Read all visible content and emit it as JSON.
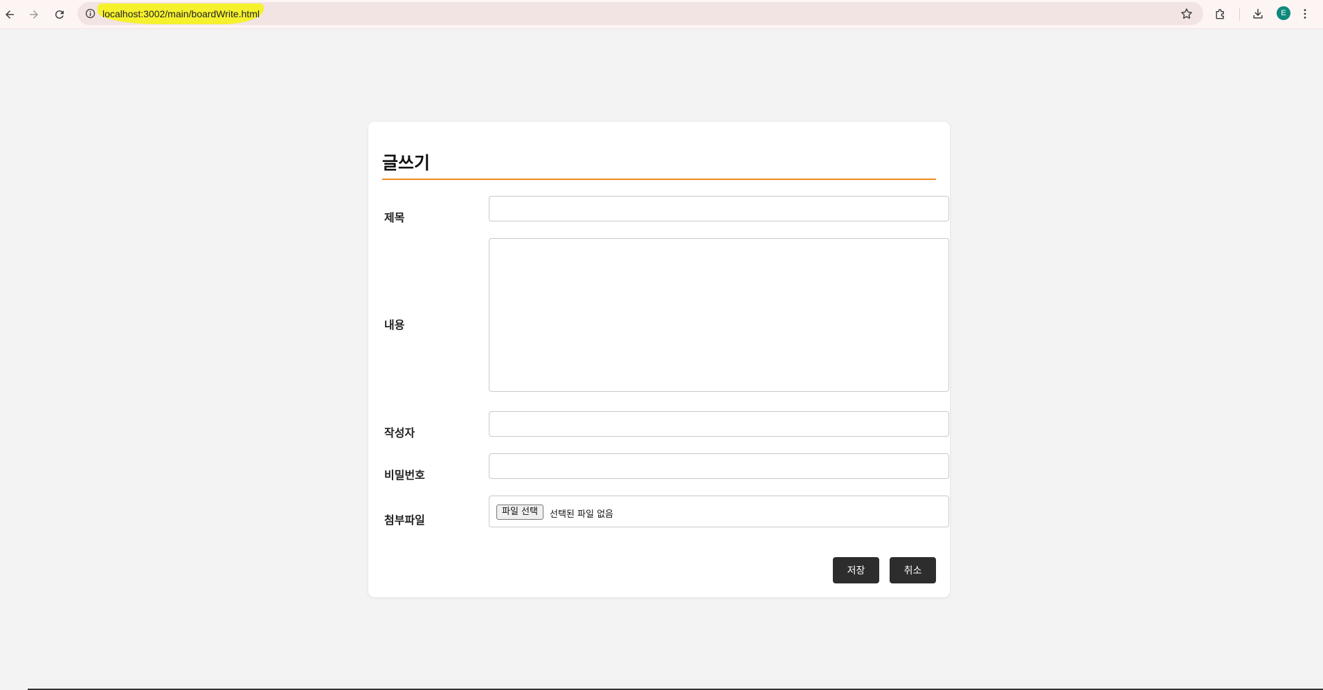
{
  "browser": {
    "url": "localhost:3002/main/boardWrite.html",
    "avatar_initial": "E",
    "avatar_color": "#0e8a7d",
    "url_highlight_color": "#f6f12d"
  },
  "form": {
    "title": "글쓰기",
    "accent_color": "#f08a1c",
    "labels": {
      "subject": "제목",
      "content": "내용",
      "author": "작성자",
      "password": "비밀번호",
      "attachment": "첨부파일"
    },
    "values": {
      "subject": "",
      "content": "",
      "author": "",
      "password": ""
    },
    "file_button_label": "파일 선택",
    "file_status": "선택된 파일 없음",
    "save_label": "저장",
    "cancel_label": "취소"
  }
}
